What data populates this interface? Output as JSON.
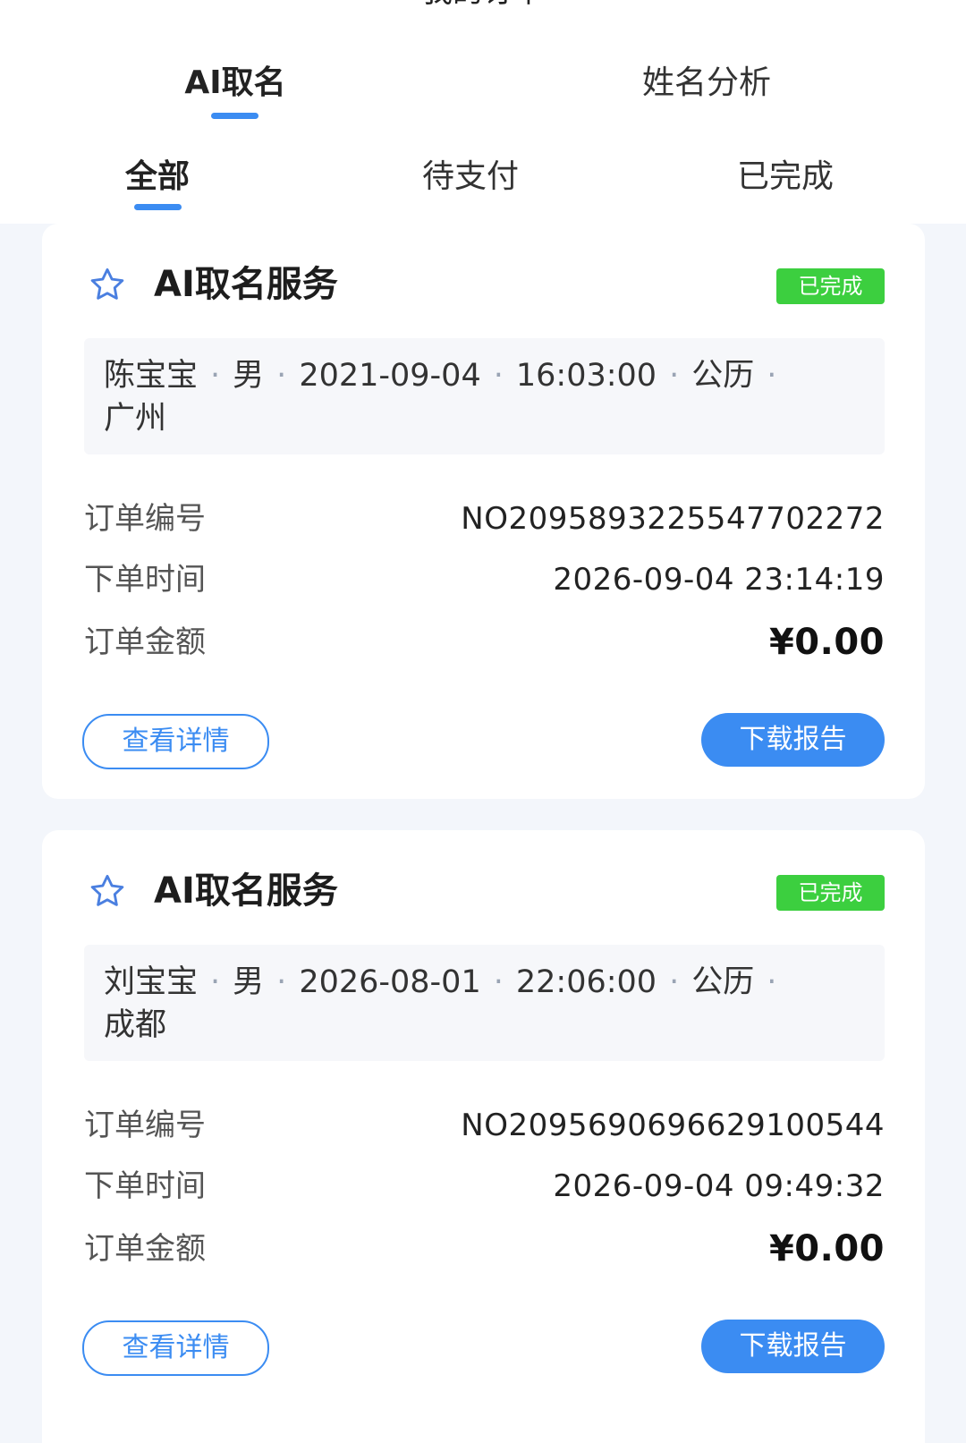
{
  "header": {
    "page_title": "我的订单",
    "main_tabs": [
      {
        "label": "AI取名",
        "active": true
      },
      {
        "label": "姓名分析",
        "active": false
      }
    ],
    "sub_tabs": [
      {
        "label": "全部",
        "active": true
      },
      {
        "label": "待支付",
        "active": false
      },
      {
        "label": "已完成",
        "active": false
      }
    ]
  },
  "orders": [
    {
      "title": "AI取名服务",
      "status": "已完成",
      "info": {
        "name": "陈宝宝",
        "gender": "男",
        "date": "2021-09-04",
        "time": "16:03:00",
        "calendar": "公历",
        "city": "广州"
      },
      "rows": [
        {
          "label": "订单编号",
          "value": "NO2095893225547702272"
        },
        {
          "label": "下单时间",
          "value": "2026-09-04 23:14:19"
        },
        {
          "label": "订单金额",
          "value": "¥0.00"
        }
      ],
      "detail_button": "查看详情",
      "download_button": "下载报告"
    },
    {
      "title": "AI取名服务",
      "status": "已完成",
      "info": {
        "name": "刘宝宝",
        "gender": "男",
        "date": "2026-08-01",
        "time": "22:06:00",
        "calendar": "公历",
        "city": "成都"
      },
      "rows": [
        {
          "label": "订单编号",
          "value": "NO2095690696629100544"
        },
        {
          "label": "下单时间",
          "value": "2026-09-04 09:49:32"
        },
        {
          "label": "订单金额",
          "value": "¥0.00"
        }
      ],
      "detail_button": "查看详情",
      "download_button": "下载报告"
    }
  ],
  "colors": {
    "accent": "#3b8cf2",
    "status_green": "#3ccf3f",
    "page_bg": "#f3f6fb"
  },
  "icons": {
    "favorite": "star-icon"
  }
}
